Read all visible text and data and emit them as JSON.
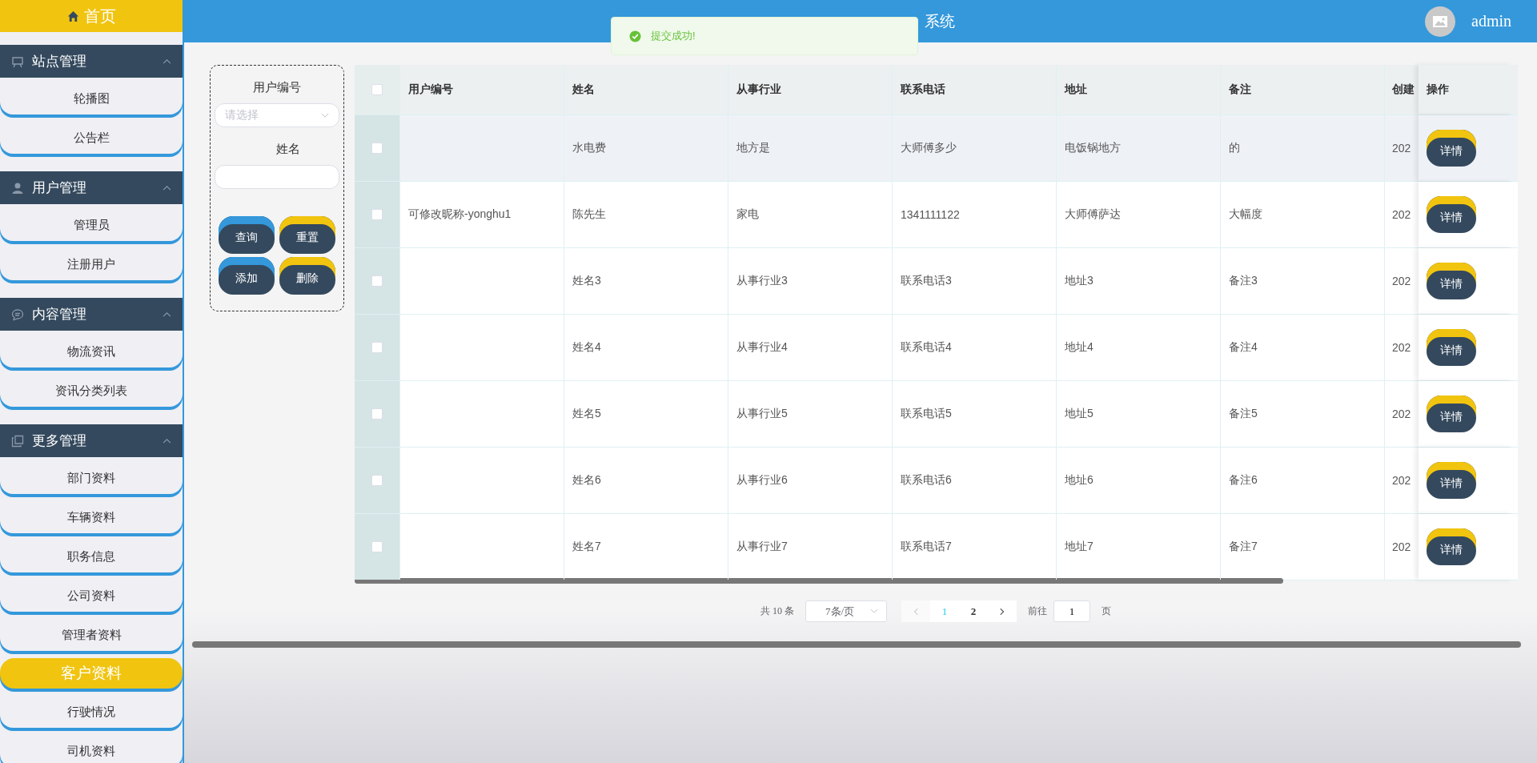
{
  "sidebar": {
    "home": "首页",
    "groups": [
      {
        "title": "站点管理",
        "expanded": true,
        "items": [
          {
            "label": "轮播图",
            "selected": false
          },
          {
            "label": "公告栏",
            "selected": false
          }
        ]
      },
      {
        "title": "用户管理",
        "expanded": true,
        "items": [
          {
            "label": "管理员",
            "selected": false
          },
          {
            "label": "注册用户",
            "selected": false
          }
        ]
      },
      {
        "title": "内容管理",
        "expanded": true,
        "items": [
          {
            "label": "物流资讯",
            "selected": false
          },
          {
            "label": "资讯分类列表",
            "selected": false
          }
        ]
      },
      {
        "title": "更多管理",
        "expanded": true,
        "items": [
          {
            "label": "部门资料",
            "selected": false
          },
          {
            "label": "车辆资料",
            "selected": false
          },
          {
            "label": "职务信息",
            "selected": false
          },
          {
            "label": "公司资料",
            "selected": false
          },
          {
            "label": "管理者资料",
            "selected": false
          },
          {
            "label": "客户资料",
            "selected": true
          },
          {
            "label": "行驶情况",
            "selected": false
          },
          {
            "label": "司机资料",
            "selected": false
          }
        ]
      }
    ]
  },
  "header": {
    "title": "系统",
    "user": "admin"
  },
  "toast": {
    "message": "提交成功!"
  },
  "filter": {
    "fields": [
      {
        "kind": "select",
        "label": "用户编号",
        "placeholder": "请选择"
      },
      {
        "kind": "input",
        "label": "姓名"
      }
    ],
    "buttons": [
      {
        "label": "查询",
        "color": "#3498db"
      },
      {
        "label": "重置",
        "color": "#f1c40f"
      },
      {
        "label": "添加",
        "color": "#3498db"
      },
      {
        "label": "删除",
        "color": "#f1c40f"
      }
    ]
  },
  "table": {
    "columns": [
      "用户编号",
      "姓名",
      "从事行业",
      "联系电话",
      "地址",
      "备注",
      "创建"
    ],
    "action_column": "操作",
    "select_all_checked": false,
    "rows": [
      {
        "checked": false,
        "hover": true,
        "cells": [
          "",
          "水电费",
          "地方是",
          "大师傅多少",
          "电饭锅地方",
          "的",
          "202"
        ],
        "action": "详情"
      },
      {
        "checked": false,
        "hover": false,
        "cells": [
          "可修改昵称-yonghu1",
          "陈先生",
          "家电",
          "1341111122",
          "大师傅萨达",
          "大幅度",
          "202"
        ],
        "action": "详情"
      },
      {
        "checked": false,
        "hover": false,
        "cells": [
          "",
          "姓名3",
          "从事行业3",
          "联系电话3",
          "地址3",
          "备注3",
          "202"
        ],
        "action": "详情"
      },
      {
        "checked": false,
        "hover": false,
        "cells": [
          "",
          "姓名4",
          "从事行业4",
          "联系电话4",
          "地址4",
          "备注4",
          "202"
        ],
        "action": "详情"
      },
      {
        "checked": false,
        "hover": false,
        "cells": [
          "",
          "姓名5",
          "从事行业5",
          "联系电话5",
          "地址5",
          "备注5",
          "202"
        ],
        "action": "详情"
      },
      {
        "checked": false,
        "hover": false,
        "cells": [
          "",
          "姓名6",
          "从事行业6",
          "联系电话6",
          "地址6",
          "备注6",
          "202"
        ],
        "action": "详情"
      },
      {
        "checked": false,
        "hover": false,
        "cells": [
          "",
          "姓名7",
          "从事行业7",
          "联系电话7",
          "地址7",
          "备注7",
          "202"
        ],
        "action": "详情"
      }
    ]
  },
  "pagination": {
    "total": "共 10 条",
    "page_size": "7条/页",
    "pages": [
      {
        "label": "1",
        "selected": true
      },
      {
        "label": "2",
        "selected": false
      }
    ],
    "goto_label": "前往",
    "goto_value": "1",
    "page_unit": "页"
  }
}
